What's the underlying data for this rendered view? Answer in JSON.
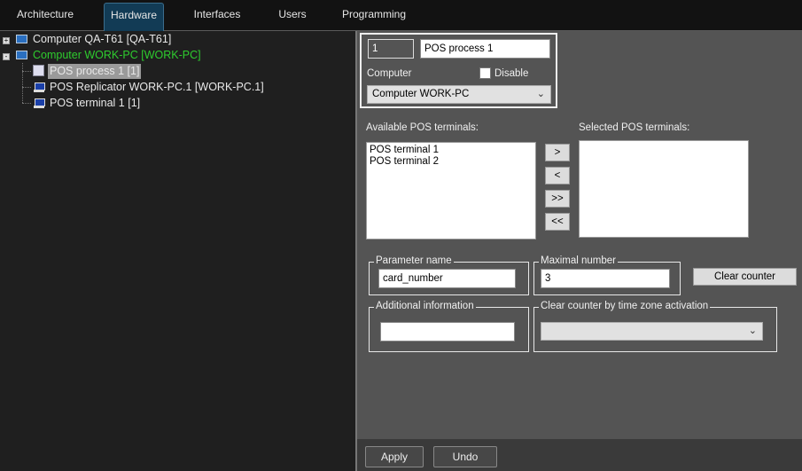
{
  "tabs": [
    "Architecture",
    "Hardware",
    "Interfaces",
    "Users",
    "Programming"
  ],
  "active_tab": "Hardware",
  "tree": {
    "nodes": [
      {
        "label": "Computer QA-T61 [QA-T61]",
        "expander": "+"
      },
      {
        "label": "Computer WORK-PC [WORK-PC]",
        "expander": "-",
        "color": "#2ecc2e"
      },
      {
        "label": "POS process 1 [1]",
        "selected": true
      },
      {
        "label": "POS Replicator WORK-PC.1 [WORK-PC.1]"
      },
      {
        "label": "POS terminal 1 [1]"
      }
    ]
  },
  "form": {
    "id_value": "1",
    "name_value": "POS process 1",
    "computer_label": "Computer",
    "disable_label": "Disable",
    "disable_checked": false,
    "computer_select": "Computer WORK-PC",
    "available_label": "Available POS terminals:",
    "available_items": [
      "POS terminal 1",
      "POS terminal 2"
    ],
    "selected_label": "Selected POS terminals:",
    "move_buttons": [
      ">",
      "<",
      ">>",
      "<<"
    ],
    "param_name_label": "Parameter name",
    "param_name_value": "card_number",
    "max_number_label": "Maximal number",
    "max_number_value": "3",
    "clear_counter_label": "Clear counter",
    "additional_info_label": "Additional information",
    "additional_info_value": "",
    "clear_by_tz_label": "Clear counter by time zone activation",
    "clear_by_tz_value": ""
  },
  "footer": {
    "apply": "Apply",
    "undo": "Undo"
  }
}
